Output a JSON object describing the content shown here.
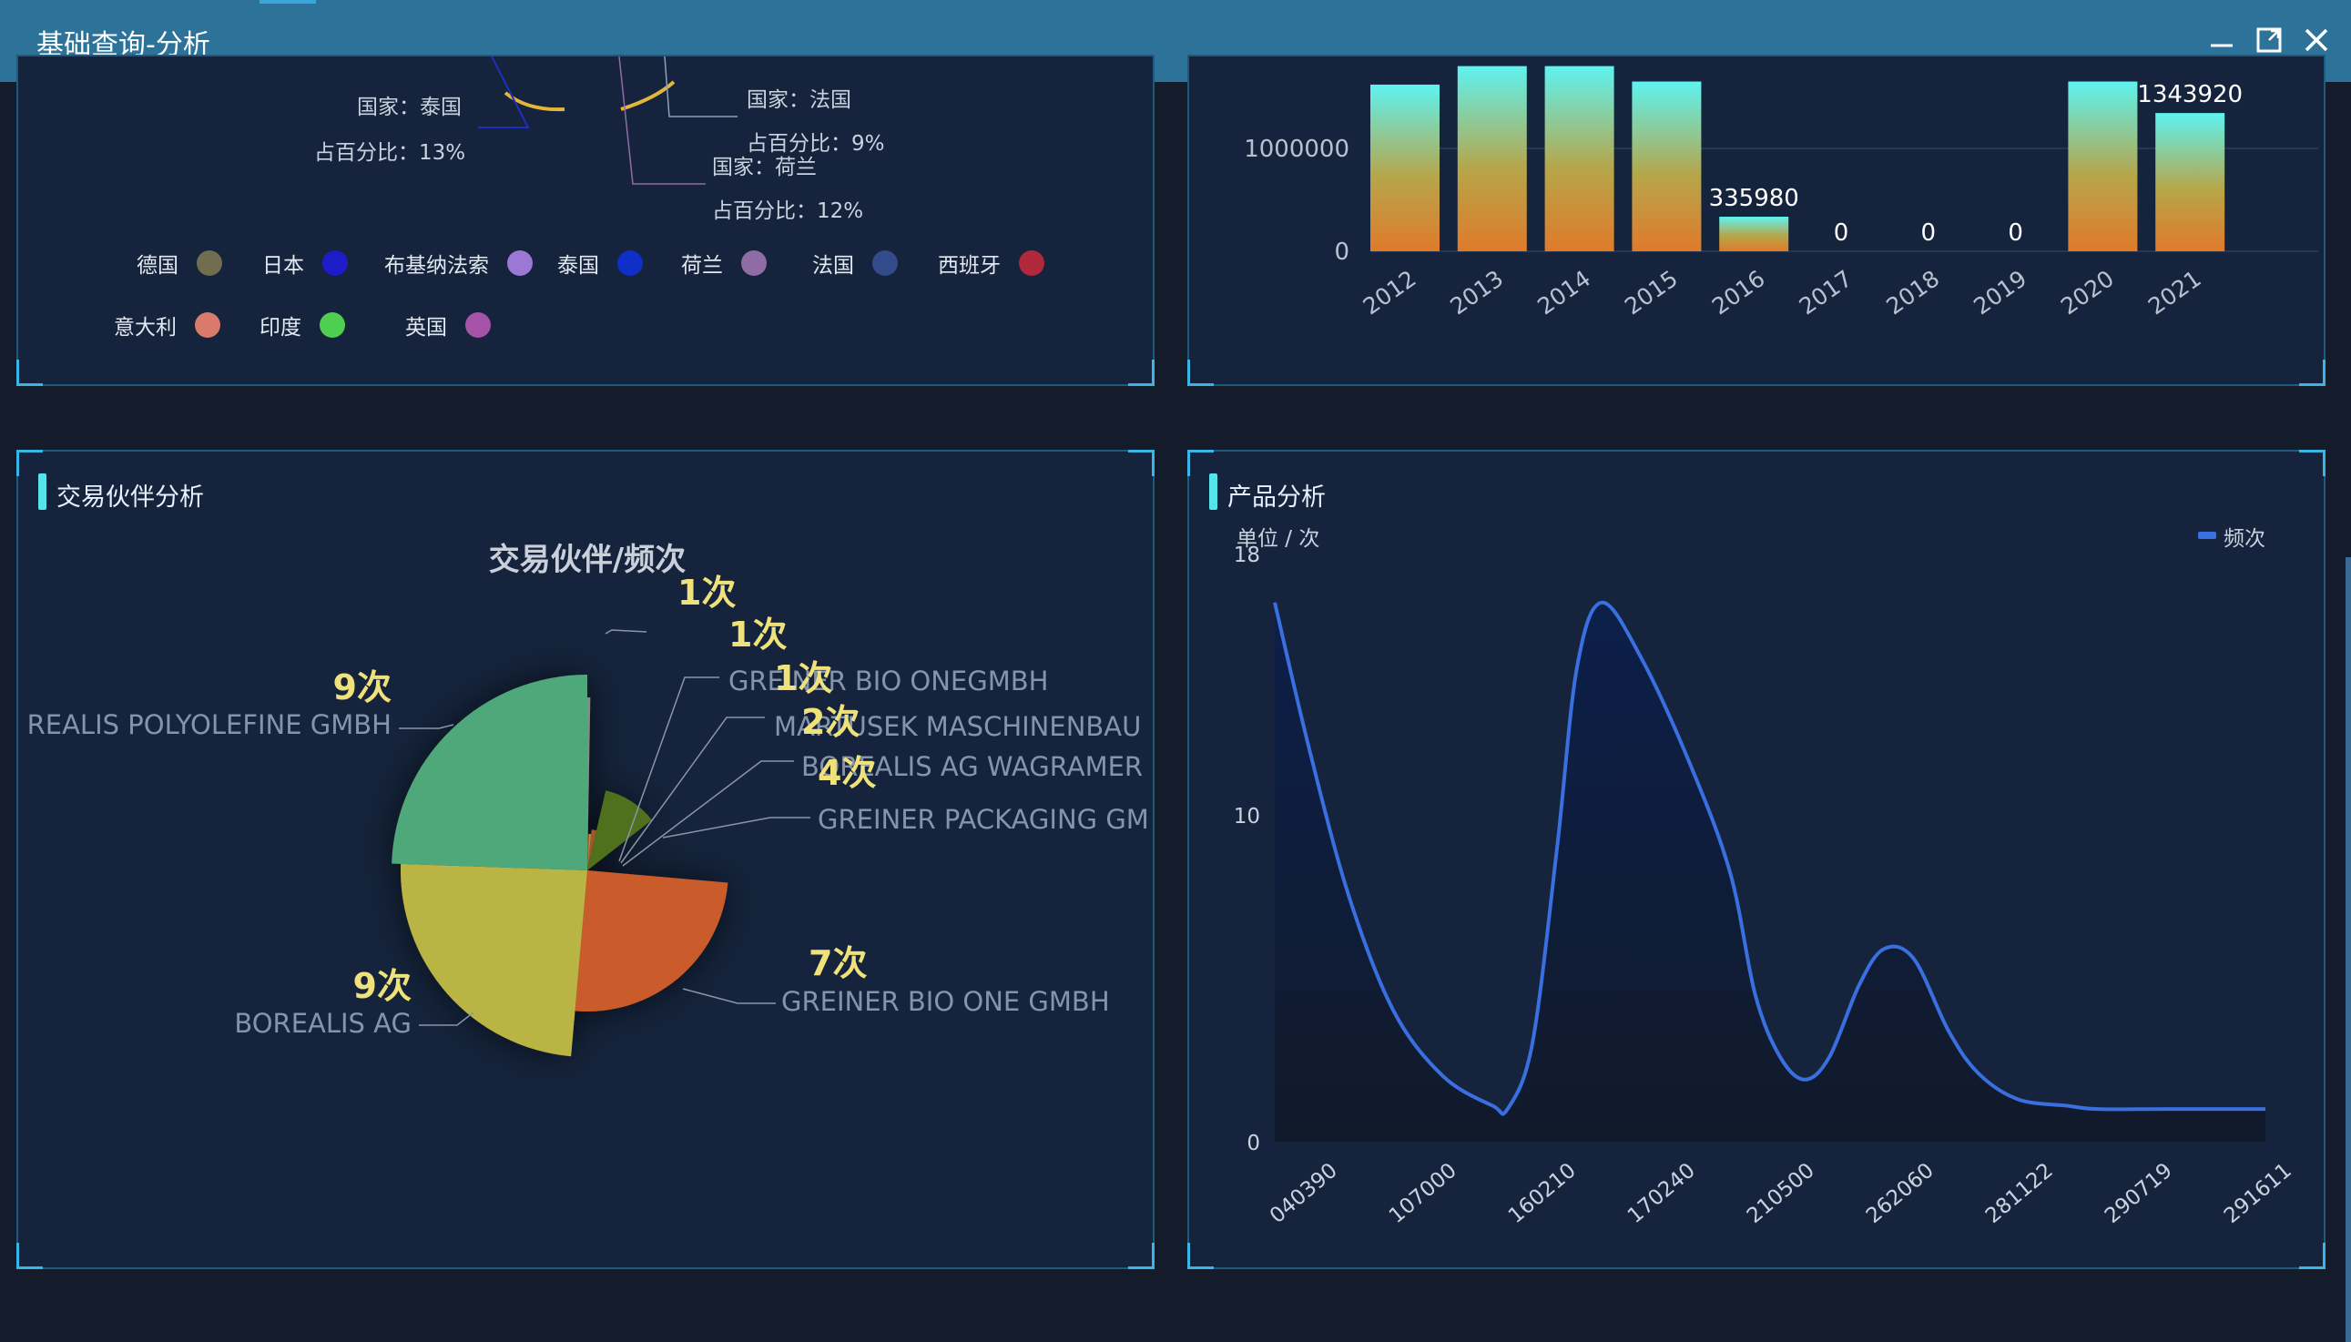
{
  "window": {
    "title": "基础查询-分析"
  },
  "top_left": {
    "labels": [
      {
        "country": "国家：泰国",
        "percent": "占百分比：13%"
      },
      {
        "country": "国家：法国",
        "percent": "占百分比：9%"
      },
      {
        "country": "国家：荷兰",
        "percent": "占百分比：12%"
      }
    ],
    "legend": [
      {
        "name": "德国",
        "color": "#706e4e"
      },
      {
        "name": "日本",
        "color": "#1d1cc8"
      },
      {
        "name": "布基纳法索",
        "color": "#9b78d6"
      },
      {
        "name": "泰国",
        "color": "#0f2fc9"
      },
      {
        "name": "荷兰",
        "color": "#8f6ca6"
      },
      {
        "name": "法国",
        "color": "#334b8a"
      },
      {
        "name": "西班牙",
        "color": "#b0283a"
      },
      {
        "name": "意大利",
        "color": "#d97a6a"
      },
      {
        "name": "印度",
        "color": "#4fcf4f"
      },
      {
        "name": "英国",
        "color": "#a453a8"
      }
    ]
  },
  "top_right": {
    "chart_data": {
      "type": "bar",
      "categories": [
        "2012",
        "2013",
        "2014",
        "2015",
        "2016",
        "2017",
        "2018",
        "2019",
        "2020",
        "2021"
      ],
      "values": [
        1620000,
        1800000,
        1800000,
        1650000,
        335980,
        0,
        0,
        0,
        1650000,
        1343920
      ],
      "value_labels": [
        "",
        "",
        "",
        "",
        "335980",
        "0",
        "0",
        "0",
        "",
        "1343920"
      ],
      "yticks": [
        "1000000",
        "0"
      ],
      "ylim": [
        0,
        1000000
      ]
    }
  },
  "partner": {
    "panel_title": "交易伙伴分析",
    "chart_data": {
      "type": "pie",
      "title": "交易伙伴/频次",
      "slices": [
        {
          "name": "GREINER BIO ONE GMBH",
          "count_label": "7次",
          "value": 7,
          "color": "#c95b2b"
        },
        {
          "name": "BOREALIS AG",
          "count_label": "9次",
          "value": 9,
          "color": "#bab444"
        },
        {
          "name": "REALIS POLYOLEFINE GMBH",
          "count_label": "9次",
          "value": 9,
          "color": "#4fa87a"
        },
        {
          "name": "",
          "count_label": "1次",
          "value": 1,
          "color": "#8a8a8a"
        },
        {
          "name": "GREINER BIO ONEGMBH",
          "count_label": "1次",
          "value": 1,
          "color": "#a04e2a"
        },
        {
          "name": "MARTUSEK MASCHINENBAU",
          "count_label": "1次",
          "value": 1,
          "color": "#c78a3a"
        },
        {
          "name": "BOREALIS AG WAGRAMER",
          "count_label": "2次",
          "value": 2,
          "color": "#9a5a2a"
        },
        {
          "name": "GREINER PACKAGING GM",
          "count_label": "4次",
          "value": 4,
          "color": "#4f6f1f"
        }
      ]
    }
  },
  "product": {
    "panel_title": "产品分析",
    "unit_label": "单位 / 次",
    "legend_label": "频次",
    "line_color": "#3a6fe0",
    "chart_data": {
      "type": "area",
      "x": [
        "040390",
        "107000",
        "160210",
        "170240",
        "210500",
        "262060",
        "281122",
        "290719",
        "291611"
      ],
      "yticks": [
        "18",
        "10",
        "0"
      ],
      "ylim": [
        0,
        18
      ],
      "series": [
        {
          "name": "频次",
          "values": [
            16.5,
            1,
            16.5,
            1.5,
            6,
            1.5,
            1,
            1,
            1
          ]
        }
      ]
    }
  }
}
